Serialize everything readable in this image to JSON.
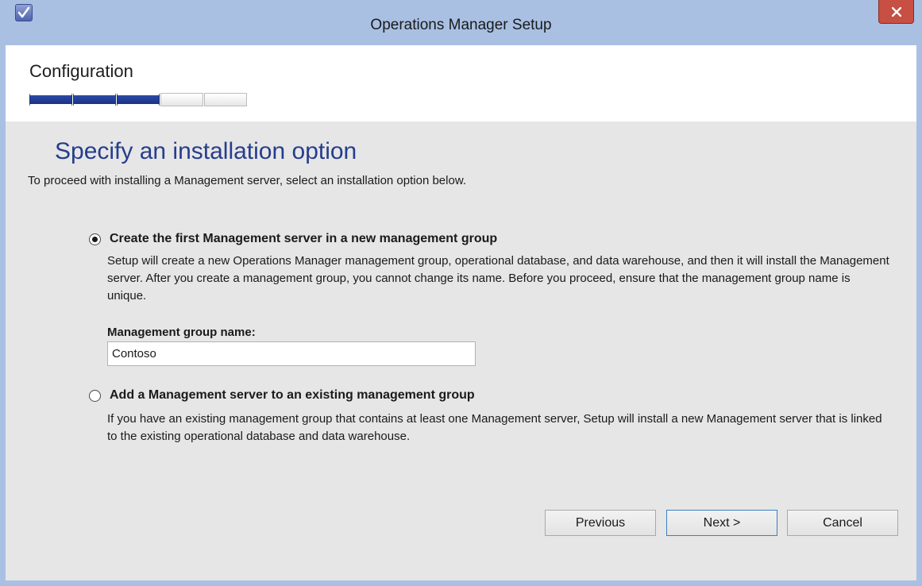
{
  "window": {
    "title": "Operations Manager Setup"
  },
  "header": {
    "section": "Configuration",
    "progress": {
      "completed_steps": 3,
      "total_steps": 5
    }
  },
  "page": {
    "title": "Specify an installation option",
    "intro": "To proceed with installing a Management server, select an installation option below."
  },
  "options": [
    {
      "label": "Create the first Management server in a new management group",
      "selected": true,
      "description": "Setup will create a new Operations Manager management group, operational database, and data warehouse, and then it will install the Management server. After you create a management group, you cannot change its name. Before you proceed, ensure that the management group name is unique."
    },
    {
      "label": "Add a Management server to an existing management group",
      "selected": false,
      "description": "If you have an existing management group that contains at least one Management server, Setup will install a new Management server that is linked to the existing operational database and data warehouse."
    }
  ],
  "management_group": {
    "label": "Management group name:",
    "value": "Contoso"
  },
  "buttons": {
    "previous": "Previous",
    "next": "Next >",
    "cancel": "Cancel"
  },
  "icons": {
    "app": "setup-check-icon",
    "close": "close-icon"
  },
  "colors": {
    "title_bar": "#a9c0e3",
    "page_title": "#263d8c",
    "progress_fill": "#1f3a96",
    "close_button": "#c74f43"
  }
}
